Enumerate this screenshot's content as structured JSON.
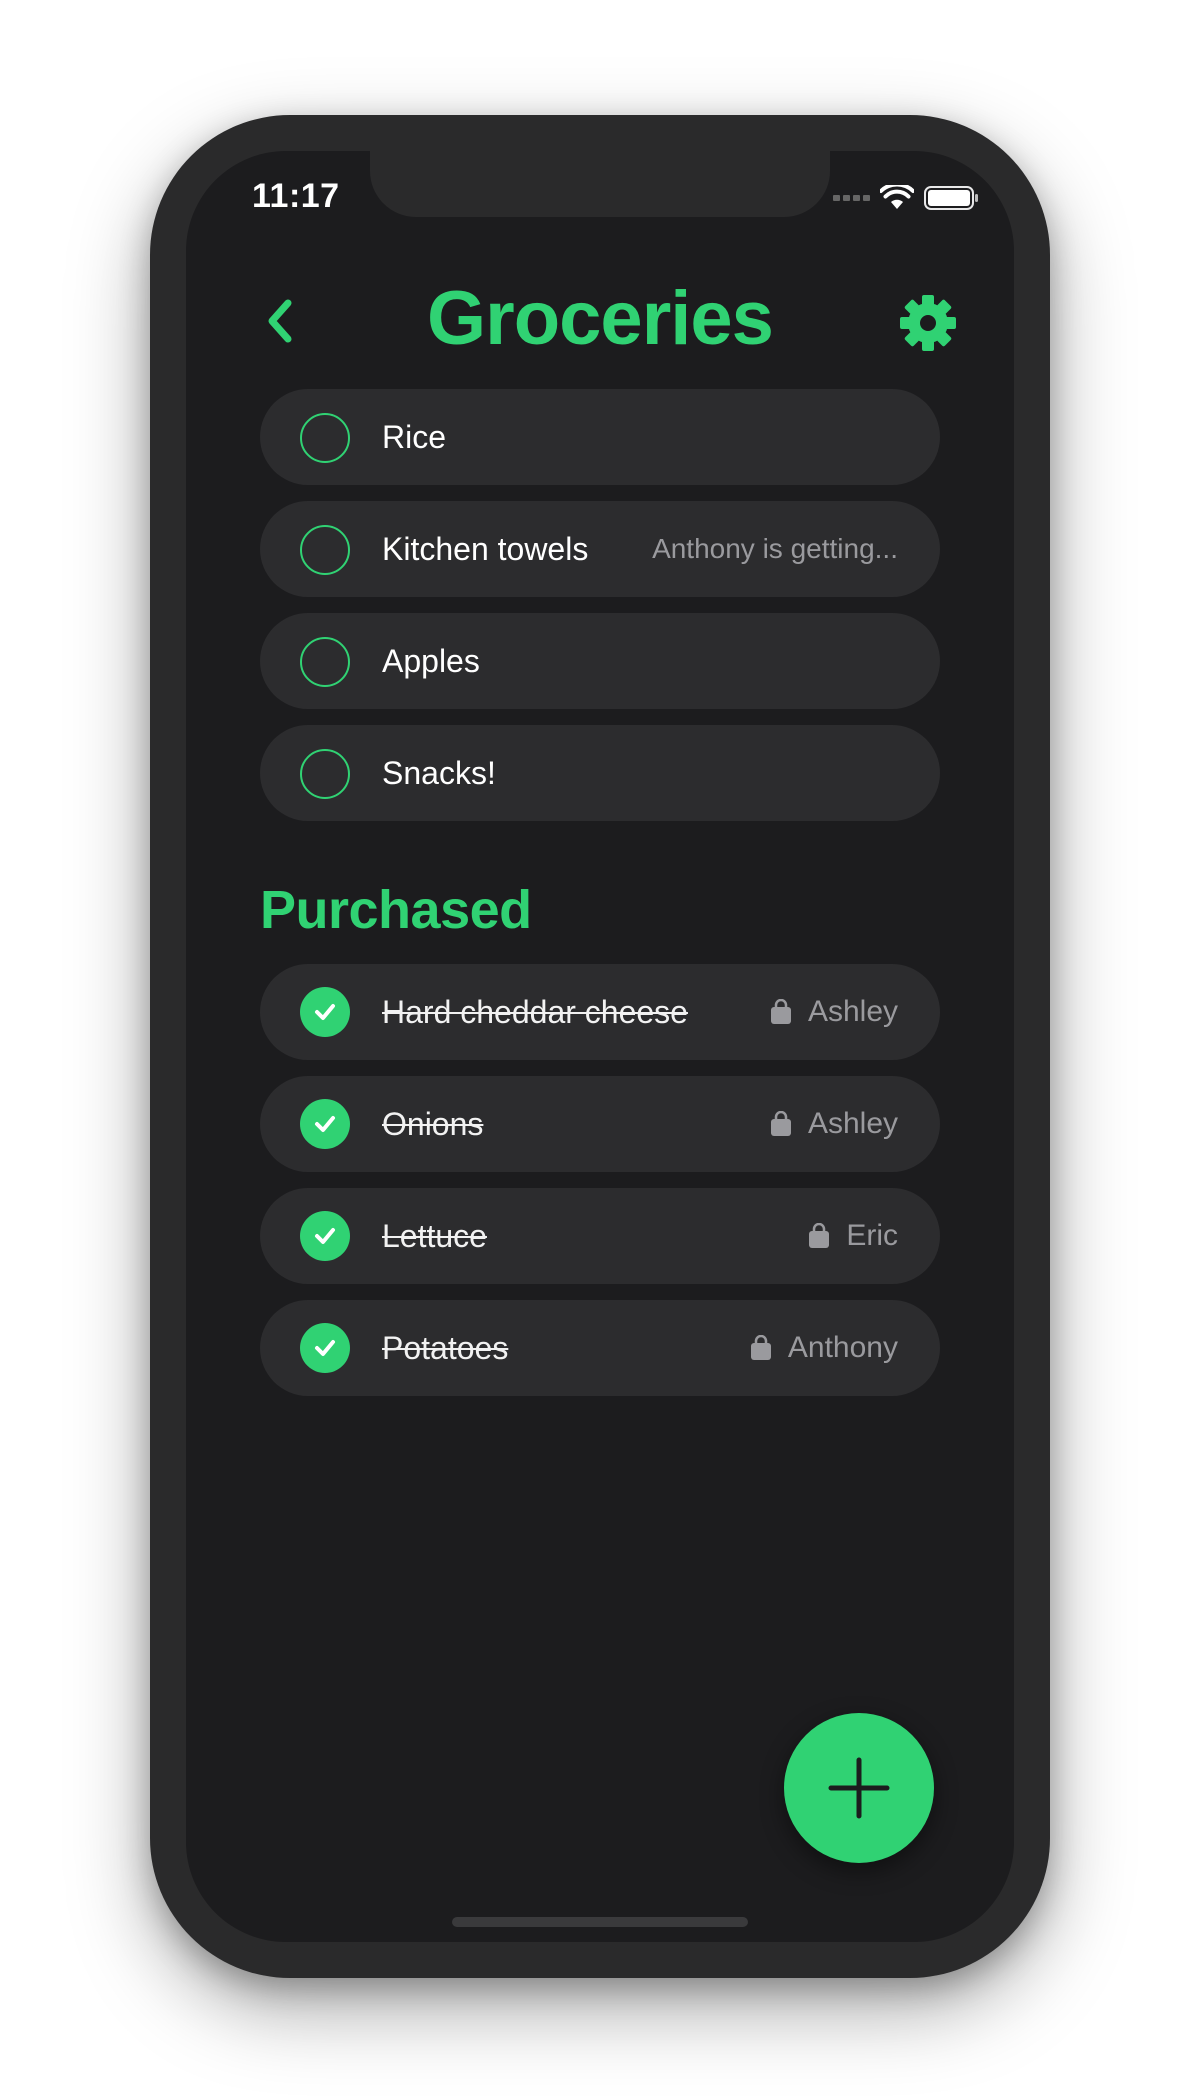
{
  "status_bar": {
    "time": "11:17",
    "signal_icon": "cellular-signal-icon",
    "wifi_icon": "wifi-icon",
    "battery_icon": "battery-icon"
  },
  "header": {
    "title": "Groceries",
    "back_icon": "chevron-left-icon",
    "settings_icon": "gear-icon"
  },
  "todo_items": [
    {
      "label": "Rice",
      "note": ""
    },
    {
      "label": "Kitchen towels",
      "note": "Anthony is getting..."
    },
    {
      "label": "Apples",
      "note": ""
    },
    {
      "label": "Snacks!",
      "note": ""
    }
  ],
  "purchased": {
    "title": "Purchased",
    "items": [
      {
        "label": "Hard cheddar cheese",
        "buyer": "Ashley"
      },
      {
        "label": "Onions",
        "buyer": "Ashley"
      },
      {
        "label": "Lettuce",
        "buyer": "Eric"
      },
      {
        "label": "Potatoes",
        "buyer": "Anthony"
      }
    ]
  },
  "fab": {
    "icon": "plus-icon"
  },
  "colors": {
    "accent": "#30d273",
    "background": "#1c1c1e",
    "row": "#2c2c2e",
    "muted_text": "#9a9a9e"
  }
}
